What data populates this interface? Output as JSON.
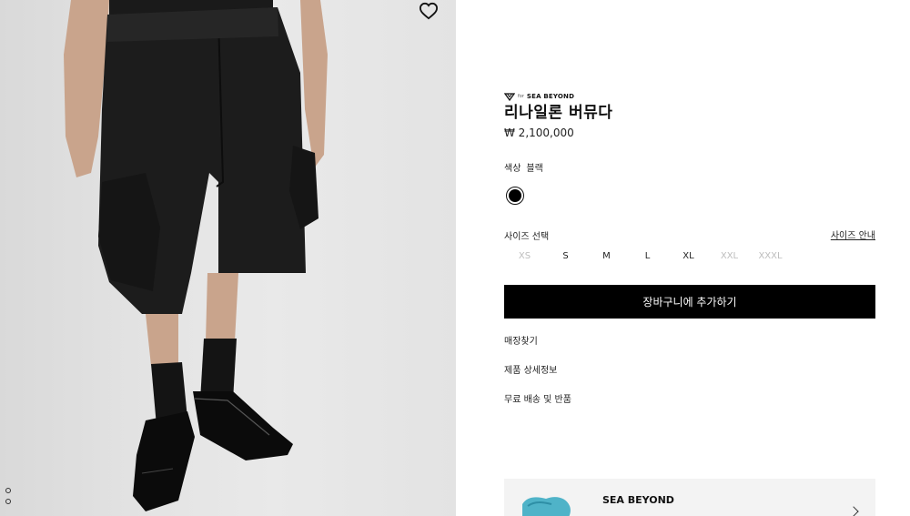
{
  "product": {
    "brand_prefix": "for",
    "brand": "SEA BEYOND",
    "name": "리나일론 버뮤다",
    "price": "₩ 2,100,000",
    "color": {
      "label": "색상",
      "value": "블랙",
      "swatch_hex": "#000000"
    },
    "size": {
      "label": "사이즈 선택",
      "guide_label": "사이즈 안내",
      "options": [
        {
          "label": "XS",
          "available": false
        },
        {
          "label": "S",
          "available": true
        },
        {
          "label": "M",
          "available": true
        },
        {
          "label": "L",
          "available": true
        },
        {
          "label": "XL",
          "available": true
        },
        {
          "label": "XXL",
          "available": false
        },
        {
          "label": "XXXL",
          "available": false
        }
      ]
    },
    "add_to_bag_label": "장바구니에 추가하기",
    "links": [
      "매장찾기",
      "제품 상세정보",
      "무료 배송 및 반품"
    ]
  },
  "sea_beyond_card": {
    "title": "SEA BEYOND"
  },
  "gallery": {
    "slide_count": 2,
    "active_index": 0
  },
  "colors": {
    "accent": "#000000",
    "disabled_text": "#bdbdbd",
    "card_bg": "#f3f3f3"
  },
  "icons": {
    "wishlist": "heart-icon",
    "brand_logo": "sea-beyond-logo-icon",
    "card_arrow": "chevron-right-icon"
  }
}
